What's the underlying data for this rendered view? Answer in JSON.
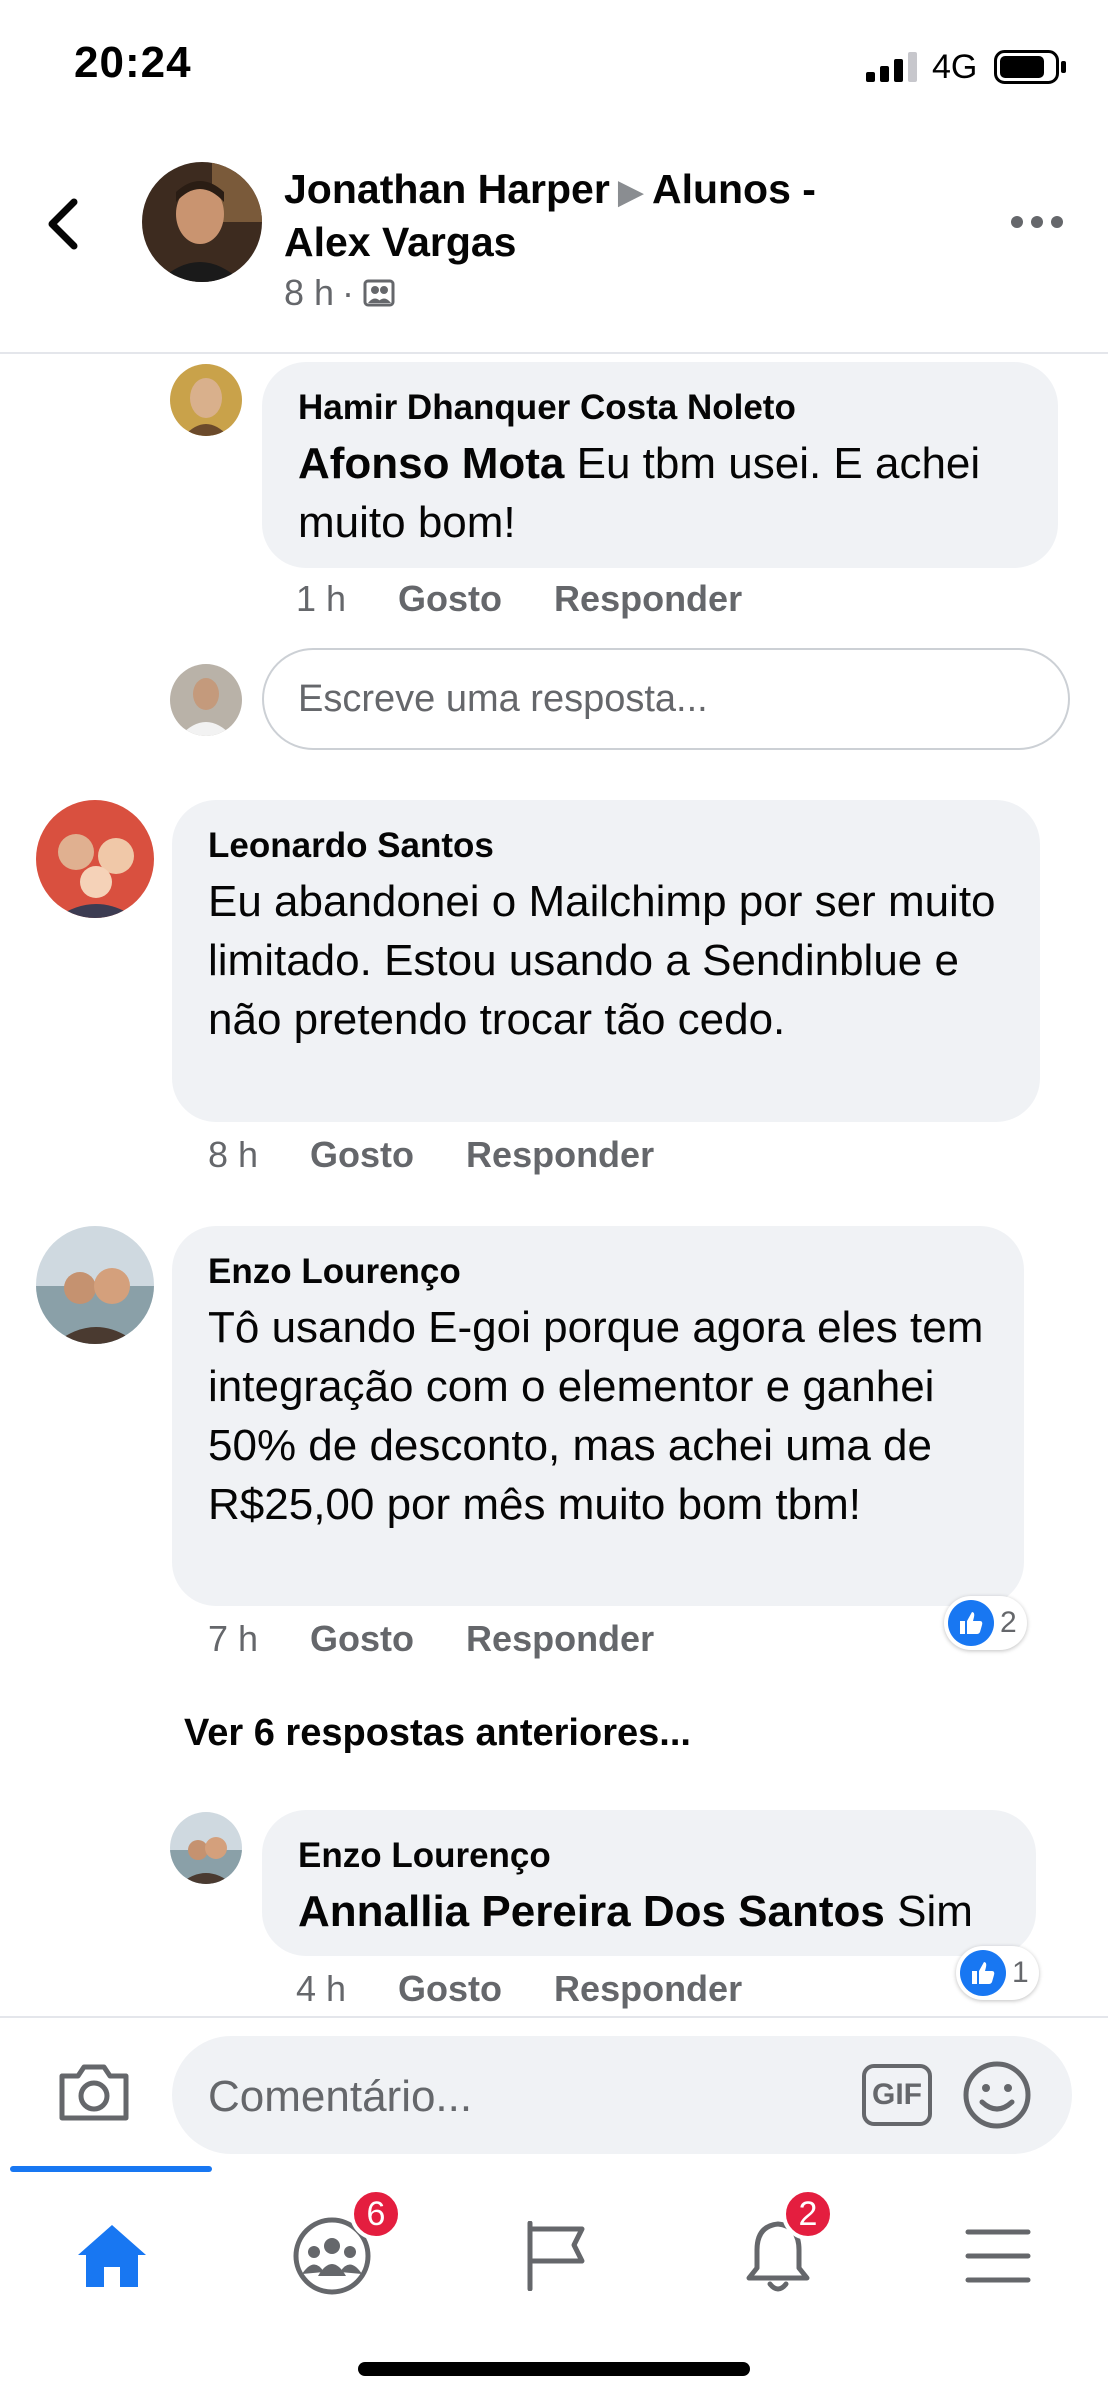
{
  "status_bar": {
    "time": "20:24",
    "network": "4G"
  },
  "header": {
    "author": "Jonathan Harper",
    "group": "Alunos -",
    "group_line2": "Alex Vargas",
    "time": "8 h"
  },
  "comments": [
    {
      "name": "Hamir Dhanquer Costa Noleto",
      "mention": "Afonso Mota",
      "text": " Eu tbm usei. E achei muito bom!",
      "time": "1 h",
      "like": "Gosto",
      "reply": "Responder"
    },
    {
      "name": "Leonardo Santos",
      "text": "Eu abandonei o Mailchimp por ser muito limitado. Estou usando a Sendinblue e não pretendo trocar tão cedo.",
      "time": "8 h",
      "like": "Gosto",
      "reply": "Responder"
    },
    {
      "name": "Enzo Lourenço",
      "text": "Tô usando E-goi porque agora eles tem integração com o elementor e ganhei 50% de desconto, mas achei uma de R$25,00 por mês muito bom tbm!",
      "time": "7 h",
      "like": "Gosto",
      "reply": "Responder",
      "reactions": "2"
    },
    {
      "name": "Enzo Lourenço",
      "mention": "Annallia Pereira Dos Santos",
      "text": " Sim",
      "time": "4 h",
      "like": "Gosto",
      "reply": "Responder",
      "reactions": "1"
    }
  ],
  "reply_input_placeholder": "Escreve uma resposta...",
  "more_replies": "Ver 6 respostas anteriores...",
  "composer": {
    "placeholder": "Comentário...",
    "gif": "GIF"
  },
  "nav": {
    "groups_badge": "6",
    "notifications_badge": "2"
  },
  "colors": {
    "accent": "#1877f2",
    "badge": "#e41e3f",
    "bubble": "#f0f2f5"
  }
}
